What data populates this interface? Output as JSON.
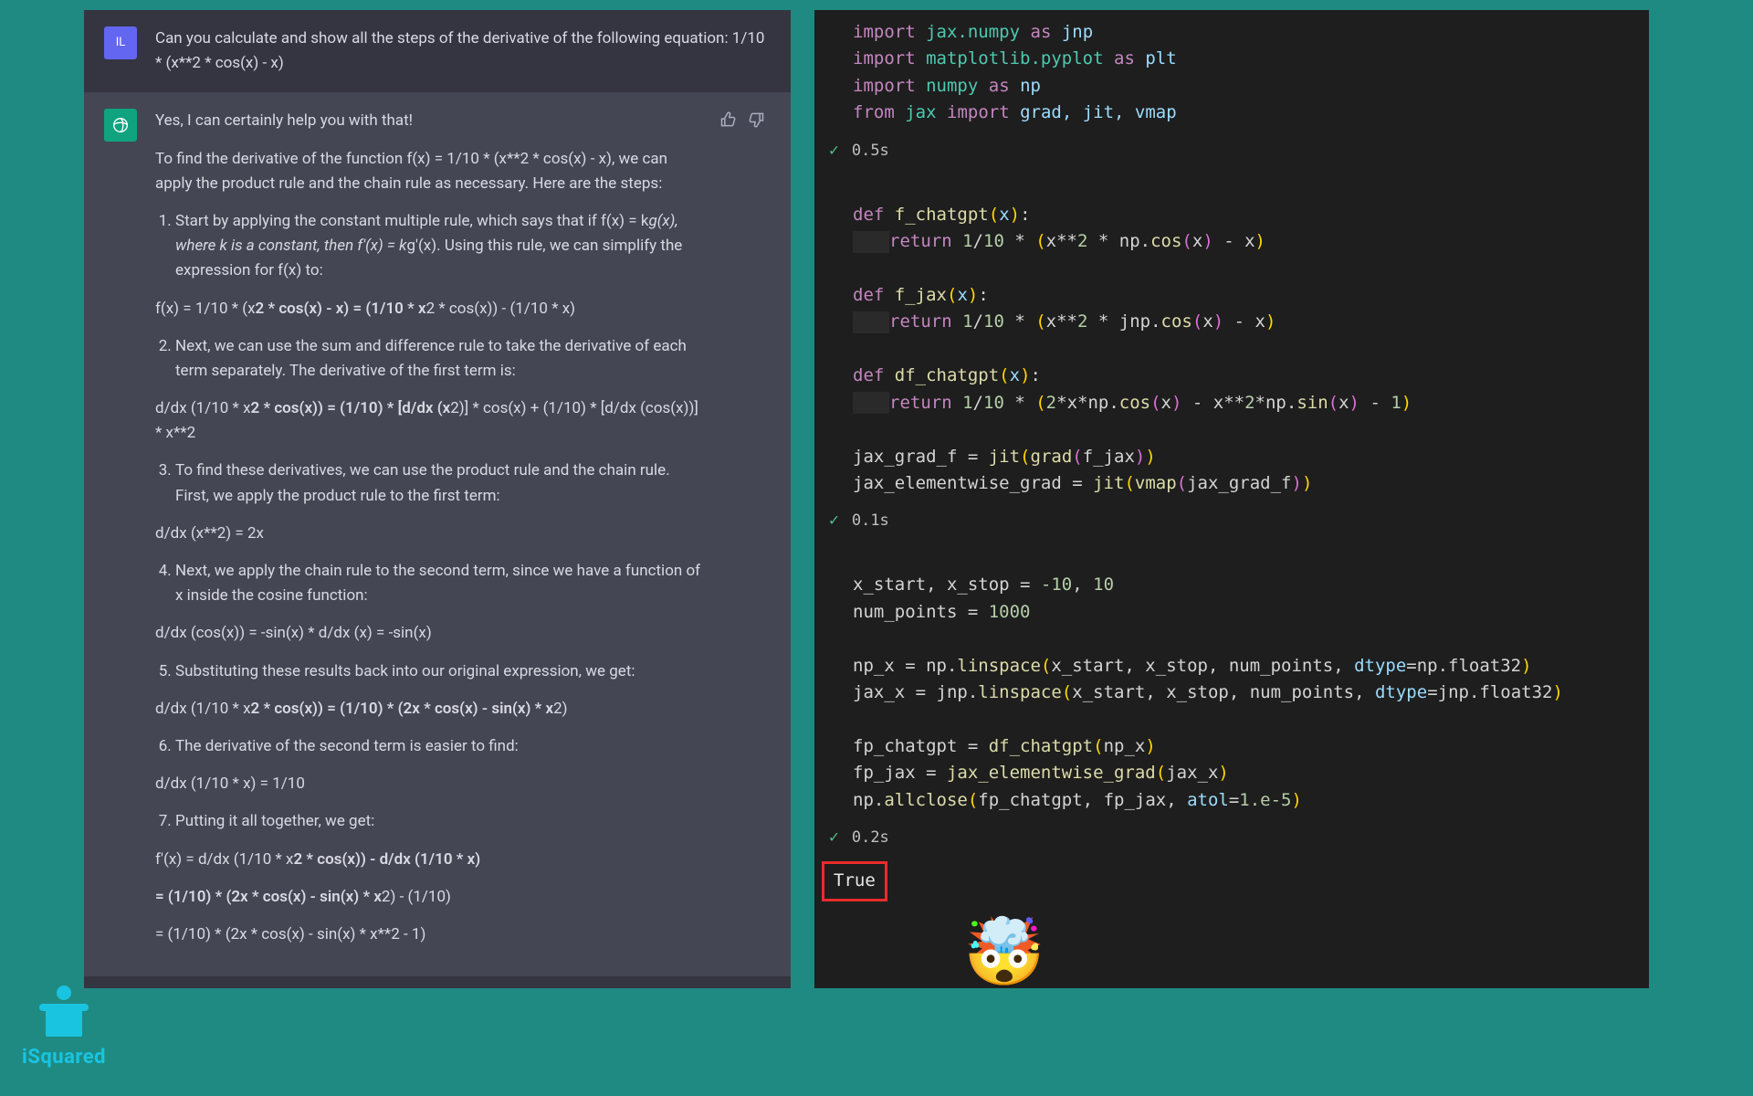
{
  "chat": {
    "user_avatar_initials": "IL",
    "user_message": "Can you calculate and show all the steps of the derivative of the following equation: 1/10 * (x**2 * cos(x) - x)",
    "assist_intro": "Yes, I can certainly help you with that!",
    "assist_lead": "To find the derivative of the function f(x) = 1/10 * (x**2 * cos(x) - x), we can apply the product rule and the chain rule as necessary. Here are the steps:",
    "step1_a": "Start by applying the constant multiple rule, which says that if f(x) = k",
    "step1_b": "g(x), where k is a constant, then f'(x) = k",
    "step1_c": "g'(x). Using this rule, we can simplify the expression for f(x) to:",
    "eq1_a": "f(x) = 1/10 * (x",
    "eq1_b": "2 * cos(x) - x) = (1/10 * x",
    "eq1_c": "2 * cos(x)) - (1/10 * x)",
    "step2": "Next, we can use the sum and difference rule to take the derivative of each term separately. The derivative of the first term is:",
    "eq2_a": "d/dx (1/10 * x",
    "eq2_b": "2 * cos(x)) = (1/10) * [d/dx (x",
    "eq2_c": "2)] * cos(x) + (1/10) * [d/dx (cos(x))] * x**2",
    "step3": "To find these derivatives, we can use the product rule and the chain rule. First, we apply the product rule to the first term:",
    "eq3": "d/dx (x**2) = 2x",
    "step4": "Next, we apply the chain rule to the second term, since we have a function of x inside the cosine function:",
    "eq4": "d/dx (cos(x)) = -sin(x) * d/dx (x) = -sin(x)",
    "step5": "Substituting these results back into our original expression, we get:",
    "eq5_a": "d/dx (1/10 * x",
    "eq5_b": "2 * cos(x)) = (1/10) * (2x * cos(x) - sin(x) * x",
    "eq5_c": "2)",
    "step6": "The derivative of the second term is easier to find:",
    "eq6": "d/dx (1/10 * x) = 1/10",
    "step7": "Putting it all together, we get:",
    "eqF1_a": "f'(x) = d/dx (1/10 * x",
    "eqF1_b": "2 * cos(x)) - d/dx (1/10 * x)",
    "eqF2_a": "= (1/10) * (2x * cos(x) - sin(x) * x",
    "eqF2_b": "2) ",
    "eqF2_c": "- (1/10)",
    "eqF3": "= (1/10) * (2x * cos(x) - sin(x) * x**2 - 1)"
  },
  "notebook": {
    "cell1": {
      "l1": {
        "kw1": "import",
        "mod": "jax.numpy",
        "kw2": "as",
        "al": "jnp"
      },
      "l2": {
        "kw1": "import",
        "mod": "matplotlib.pyplot",
        "kw2": "as",
        "al": "plt"
      },
      "l3": {
        "kw1": "import",
        "mod": "numpy",
        "kw2": "as",
        "al": "np"
      },
      "l4": {
        "kw1": "from",
        "mod": "jax",
        "kw2": "import",
        "names": "grad, jit, vmap"
      },
      "time": "0.5s"
    },
    "cell2": {
      "d1": {
        "kw": "def",
        "fn": "f_chatgpt",
        "arg": "x"
      },
      "r1": {
        "kw": "return",
        "body": "1/10 * (x**2 * np.cos(x) - x)"
      },
      "d2": {
        "kw": "def",
        "fn": "f_jax",
        "arg": "x"
      },
      "r2": {
        "kw": "return",
        "body": "1/10 * (x**2 * jnp.cos(x) - x)"
      },
      "d3": {
        "kw": "def",
        "fn": "df_chatgpt",
        "arg": "x"
      },
      "r3": {
        "kw": "return",
        "body": "1/10 * (2*x*np.cos(x) - x**2*np.sin(x) - 1)"
      },
      "g1": "jax_grad_f = jit(grad(f_jax))",
      "g2": "jax_elementwise_grad = jit(vmap(jax_grad_f))",
      "time": "0.1s"
    },
    "cell3": {
      "l1": "x_start, x_stop = -10, 10",
      "l2": "num_points = 1000",
      "l3": "np_x = np.linspace(x_start, x_stop, num_points, dtype=np.float32)",
      "l4": "jax_x = jnp.linspace(x_start, x_stop, num_points, dtype=jnp.float32)",
      "l5": "fp_chatgpt = df_chatgpt(np_x)",
      "l6": "fp_jax = jax_elementwise_grad(jax_x)",
      "l7": "np.allclose(fp_chatgpt, fp_jax, atol=1.e-5)",
      "time": "0.2s",
      "out": "True"
    }
  },
  "brand": "iSquared",
  "emoji": "🤯"
}
